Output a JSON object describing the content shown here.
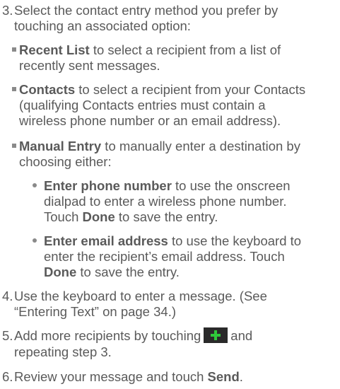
{
  "step3": {
    "number": "3.",
    "line1": "Select the contact entry method you prefer by",
    "line2": "touching an associated option:"
  },
  "recent_list": {
    "term": "Recent List",
    "line1_rest": " to select a recipient from a list of",
    "line2": "recently sent messages."
  },
  "contacts": {
    "term": "Contacts",
    "line1_rest": " to select a recipient from your Contacts",
    "line2": "(qualifying Contacts entries must contain a",
    "line3": "wireless phone number or an email address)."
  },
  "manual_entry": {
    "term": "Manual Entry",
    "line1_rest": " to manually enter a destination by",
    "line2": "choosing either:"
  },
  "enter_phone": {
    "term": "Enter phone number",
    "line1_rest": " to use the onscreen",
    "line2": "dialpad to enter a wireless phone number.",
    "line3_pre": "Touch ",
    "line3_term": "Done",
    "line3_post": " to save the entry."
  },
  "enter_email": {
    "term": "Enter email address",
    "line1_rest": " to use the keyboard to",
    "line2": "enter the recipient’s email address. Touch",
    "line3_term": "Done",
    "line3_post": " to save the entry."
  },
  "step4": {
    "number": "4.",
    "line1": "Use the keyboard to enter a message. (See",
    "line2": "“Entering Text” on page 34.)"
  },
  "step5": {
    "number": "5.",
    "line1_pre": "Add more recipients by touching",
    "line1_post": "and",
    "line2": "repeating step 3."
  },
  "step6": {
    "number": "6.",
    "line1_pre": "Review your message and touch ",
    "line1_term": "Send",
    "line1_post": "."
  },
  "icons": {
    "plus": "plus-icon",
    "plus_color": "#2fc83a",
    "plus_bg": "#2a2a2a"
  }
}
